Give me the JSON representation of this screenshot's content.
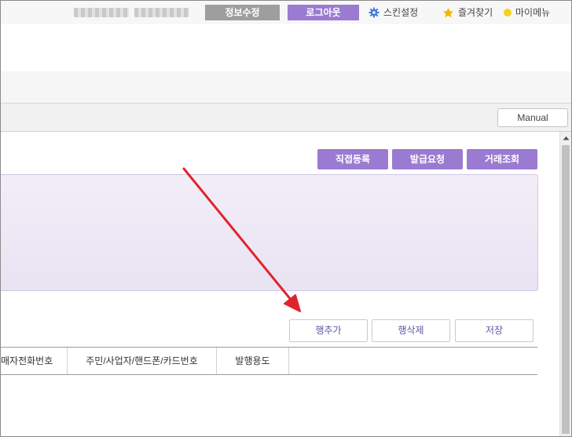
{
  "topbar": {
    "edit_info_label": "정보수정",
    "logout_label": "로그아웃",
    "skin_settings_label": "스킨설정",
    "favorites_label": "즐겨찾기",
    "mymenu_label": "마이메뉴",
    "colors": {
      "edit_button": "#9e9e9e",
      "logout_button": "#9b7bd1",
      "skin_icon": "#3f7bd6",
      "favorites_icon": "#f2b800",
      "mymenu_icon": "#f5d020"
    }
  },
  "toolbar": {
    "manual_label": "Manual"
  },
  "actions": {
    "direct_register_label": "직접등록",
    "issue_request_label": "발급요청",
    "transaction_lookup_label": "거래조회",
    "accent": "#9b7bd1"
  },
  "grid_actions": {
    "add_row_label": "행추가",
    "delete_row_label": "행삭제",
    "save_label": "저장"
  },
  "table": {
    "columns": [
      "매자전화번호",
      "주민/사업자/핸드폰/카드번호",
      "발행용도"
    ]
  },
  "annotation": {
    "arrow_color": "#e0242c"
  }
}
